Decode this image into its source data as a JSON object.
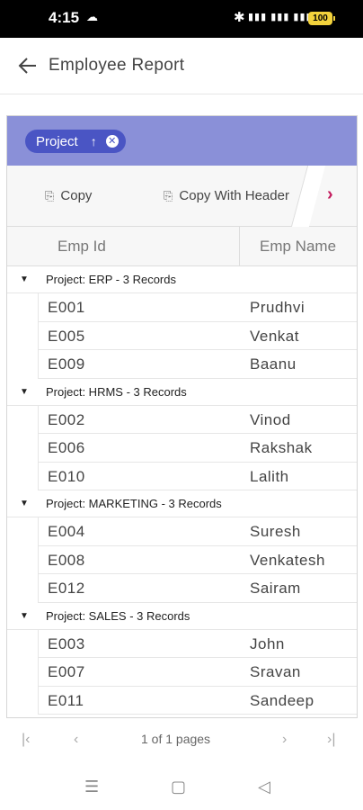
{
  "status": {
    "time": "4:15",
    "battery": "100"
  },
  "app": {
    "title": "Employee Report"
  },
  "grouping": {
    "chip_label": "Project"
  },
  "toolbar": {
    "copy_label": "Copy",
    "copy_header_label": "Copy With Header"
  },
  "columns": [
    "Emp Id",
    "Emp Name"
  ],
  "groups": [
    {
      "label": "Project: ERP - 3 Records",
      "rows": [
        [
          "E001",
          "Prudhvi"
        ],
        [
          "E005",
          "Venkat"
        ],
        [
          "E009",
          "Baanu"
        ]
      ]
    },
    {
      "label": "Project: HRMS - 3 Records",
      "rows": [
        [
          "E002",
          "Vinod"
        ],
        [
          "E006",
          "Rakshak"
        ],
        [
          "E010",
          "Lalith"
        ]
      ]
    },
    {
      "label": "Project: MARKETING - 3 Records",
      "rows": [
        [
          "E004",
          "Suresh"
        ],
        [
          "E008",
          "Venkatesh"
        ],
        [
          "E012",
          "Sairam"
        ]
      ]
    },
    {
      "label": "Project: SALES - 3 Records",
      "rows": [
        [
          "E003",
          "John"
        ],
        [
          "E007",
          "Sravan"
        ],
        [
          "E011",
          "Sandeep"
        ]
      ]
    }
  ],
  "pager": {
    "info": "1 of 1 pages"
  }
}
